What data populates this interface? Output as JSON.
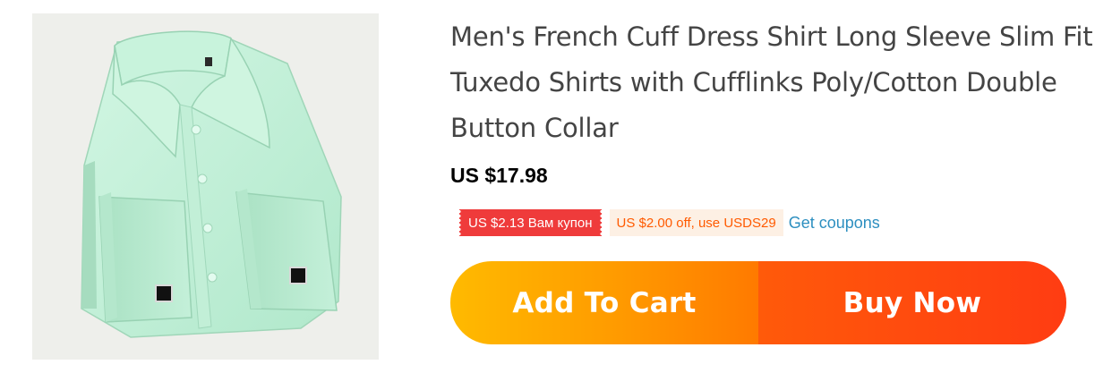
{
  "product": {
    "image_alt": "Mint green french cuff dress shirt with cufflinks",
    "title": "Men's French Cuff Dress Shirt Long Sleeve Slim Fit Tuxedo Shirts with Cufflinks Poly/Cotton Double Button Collar",
    "price": "US $17.98"
  },
  "coupons": {
    "store_coupon": "US $2.13 Вам купон",
    "code_offer": "US $2.00 off, use USDS29",
    "get_coupons_label": "Get coupons"
  },
  "actions": {
    "add_to_cart_label": "Add To Cart",
    "buy_now_label": "Buy Now"
  },
  "colors": {
    "coupon_red": "#ef3b3b",
    "offer_orange": "#ff5a00",
    "link_blue": "#2d8fc0",
    "cart_gradient_start": "#ffba00",
    "buy_gradient_start": "#ff5a0a",
    "shirt_mint": "#bfeed6"
  }
}
